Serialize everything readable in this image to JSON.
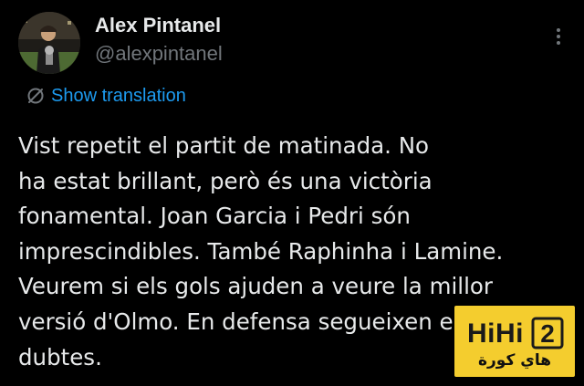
{
  "author": {
    "display_name": "Alex Pintanel",
    "handle": "@alexpintanel"
  },
  "actions": {
    "more_icon": "more-vertical-icon",
    "translate_label": "Show translation",
    "translate_icon": "translate-icon"
  },
  "tweet": {
    "text_lines": [
      "Vist repetit el partit de matinada. No",
      "ha estat brillant, però és una victòria",
      "fonamental. Joan Garcia i Pedri són",
      "imprescindibles. També Raphinha i Lamine.",
      "Veurem si els gols ajuden a veure la millor",
      "versió d'Olmo. En defensa segueixen els",
      "dubtes."
    ]
  },
  "watermark": {
    "logo_text": "HiHi2",
    "arabic_text": "هاي كورة",
    "background": "#f4cd2e"
  },
  "colors": {
    "background": "#000000",
    "text": "#e7e9ea",
    "secondary": "#71767b",
    "link": "#1d9bf0"
  }
}
